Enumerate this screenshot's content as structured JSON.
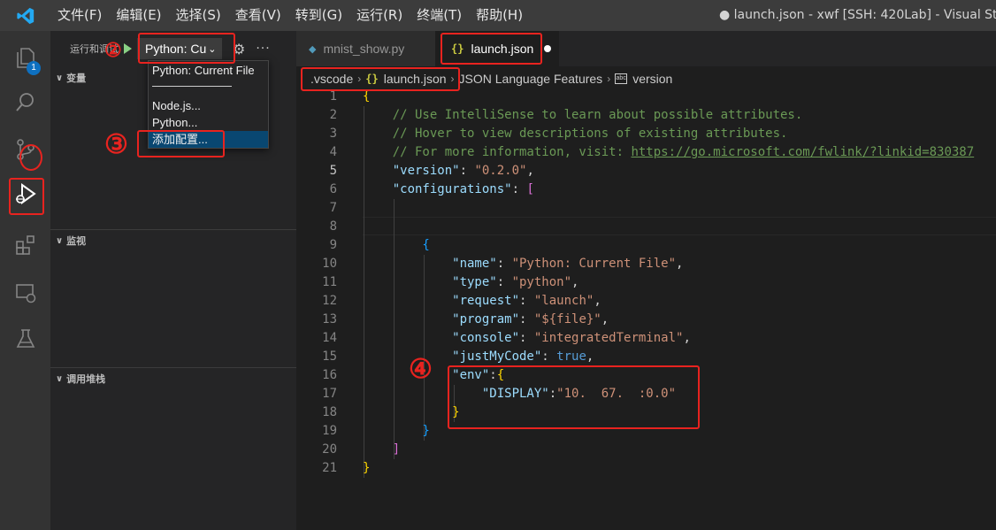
{
  "menu": {
    "items": [
      "文件(F)",
      "编辑(E)",
      "选择(S)",
      "查看(V)",
      "转到(G)",
      "运行(R)",
      "终端(T)",
      "帮助(H)"
    ],
    "window_title": "● launch.json - xwf [SSH: 420Lab] - Visual Stu"
  },
  "activitybar": {
    "explorer_badge": "1"
  },
  "sidebar": {
    "run_title": "运行和调试",
    "config_value": "Python: Cu",
    "sections": {
      "variables": "变量",
      "watch": "监视",
      "callstack": "调用堆栈"
    }
  },
  "dropdown": {
    "items": [
      "Python: Current File",
      "Node.js...",
      "Python...",
      "添加配置..."
    ]
  },
  "tabs": [
    {
      "label": "mnist_show.py"
    },
    {
      "label": "launch.json"
    }
  ],
  "breadcrumb": [
    ".vscode",
    "launch.json",
    "JSON Language Features",
    "version"
  ],
  "code": {
    "lines": [
      {
        "n": "1",
        "tokens": [
          [
            "b1",
            "{"
          ]
        ]
      },
      {
        "n": "2",
        "tokens": [
          [
            "c-com",
            "    // Use IntelliSense to learn about possible attributes."
          ]
        ]
      },
      {
        "n": "3",
        "tokens": [
          [
            "c-com",
            "    // Hover to view descriptions of existing attributes."
          ]
        ]
      },
      {
        "n": "4",
        "tokens": [
          [
            "c-com",
            "    // For more information, visit: "
          ],
          [
            "c-link",
            "https://go.microsoft.com/fwlink/?linkid=830387"
          ]
        ]
      },
      {
        "n": "5",
        "tokens": [
          [
            "c-key",
            "    \"version\""
          ],
          [
            "c-punc",
            ": "
          ],
          [
            "c-str",
            "\"0.2.0\""
          ],
          [
            "c-punc",
            ","
          ]
        ]
      },
      {
        "n": "6",
        "tokens": [
          [
            "c-key",
            "    \"configurations\""
          ],
          [
            "c-punc",
            ": "
          ],
          [
            "b2",
            "["
          ]
        ]
      },
      {
        "n": "7",
        "tokens": []
      },
      {
        "n": "8",
        "tokens": []
      },
      {
        "n": "9",
        "tokens": [
          [
            "b3",
            "        {"
          ]
        ]
      },
      {
        "n": "10",
        "tokens": [
          [
            "c-key",
            "            \"name\""
          ],
          [
            "c-punc",
            ": "
          ],
          [
            "c-str",
            "\"Python: Current File\""
          ],
          [
            "c-punc",
            ","
          ]
        ]
      },
      {
        "n": "11",
        "tokens": [
          [
            "c-key",
            "            \"type\""
          ],
          [
            "c-punc",
            ": "
          ],
          [
            "c-str",
            "\"python\""
          ],
          [
            "c-punc",
            ","
          ]
        ]
      },
      {
        "n": "12",
        "tokens": [
          [
            "c-key",
            "            \"request\""
          ],
          [
            "c-punc",
            ": "
          ],
          [
            "c-str",
            "\"launch\""
          ],
          [
            "c-punc",
            ","
          ]
        ]
      },
      {
        "n": "13",
        "tokens": [
          [
            "c-key",
            "            \"program\""
          ],
          [
            "c-punc",
            ": "
          ],
          [
            "c-str",
            "\"${file}\""
          ],
          [
            "c-punc",
            ","
          ]
        ]
      },
      {
        "n": "14",
        "tokens": [
          [
            "c-key",
            "            \"console\""
          ],
          [
            "c-punc",
            ": "
          ],
          [
            "c-str",
            "\"integratedTerminal\""
          ],
          [
            "c-punc",
            ","
          ]
        ]
      },
      {
        "n": "15",
        "tokens": [
          [
            "c-key",
            "            \"justMyCode\""
          ],
          [
            "c-punc",
            ": "
          ],
          [
            "c-bool",
            "true"
          ],
          [
            "c-punc",
            ","
          ]
        ]
      },
      {
        "n": "16",
        "tokens": [
          [
            "c-key",
            "            \"env\""
          ],
          [
            "c-punc",
            ":"
          ],
          [
            "b1",
            "{"
          ]
        ]
      },
      {
        "n": "17",
        "tokens": [
          [
            "c-key",
            "                \"DISPLAY\""
          ],
          [
            "c-punc",
            ":"
          ],
          [
            "c-str",
            "\"10.  67.  :0.0\""
          ]
        ]
      },
      {
        "n": "18",
        "tokens": [
          [
            "b1",
            "            }"
          ]
        ]
      },
      {
        "n": "19",
        "tokens": [
          [
            "b3",
            "        }"
          ]
        ]
      },
      {
        "n": "20",
        "tokens": [
          [
            "b2",
            "    ]"
          ]
        ]
      },
      {
        "n": "21",
        "tokens": [
          [
            "b1",
            "}"
          ]
        ]
      }
    ]
  },
  "annotations": [
    "②",
    "③",
    "④"
  ],
  "colors": {
    "annotation_red": "#e8231f",
    "accent": "#0e70c0",
    "selection": "#094771"
  }
}
